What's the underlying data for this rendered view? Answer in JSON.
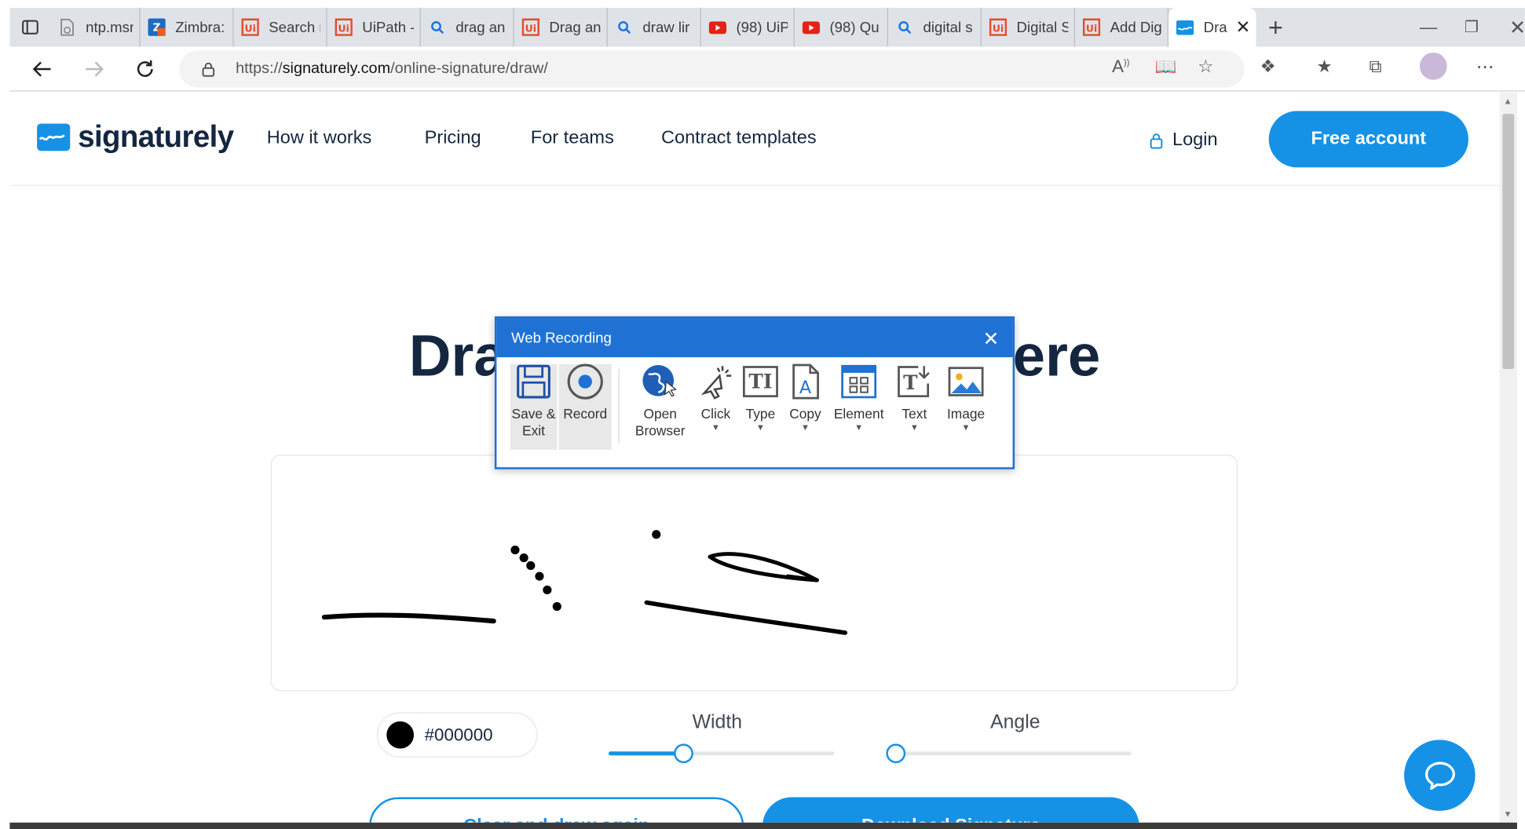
{
  "browser": {
    "tabs": [
      {
        "title": "ntp.msn",
        "icon": "msn-doc-icon",
        "icon_color": "#888888"
      },
      {
        "title": "Zimbra:",
        "icon": "zimbra-icon",
        "icon_color": "#1e6bc4"
      },
      {
        "title": "Search r",
        "icon": "uipath-icon",
        "icon_color": "#e8492b"
      },
      {
        "title": "UiPath -",
        "icon": "uipath-icon",
        "icon_color": "#e8492b"
      },
      {
        "title": "drag an",
        "icon": "search-icon",
        "icon_color": "#1a73e8"
      },
      {
        "title": "Drag an",
        "icon": "uipath-icon",
        "icon_color": "#e8492b"
      },
      {
        "title": "draw lir",
        "icon": "search-icon",
        "icon_color": "#1a73e8"
      },
      {
        "title": "(98) UiP",
        "icon": "youtube-icon",
        "icon_color": "#e62117"
      },
      {
        "title": "(98) Qu",
        "icon": "youtube-icon",
        "icon_color": "#e62117"
      },
      {
        "title": "digital s",
        "icon": "search-icon",
        "icon_color": "#1a73e8"
      },
      {
        "title": "Digital S",
        "icon": "uipath-icon",
        "icon_color": "#e8492b"
      },
      {
        "title": "Add Dig",
        "icon": "uipath-icon",
        "icon_color": "#e8492b"
      },
      {
        "title": "Dra",
        "icon": "signaturely-icon",
        "icon_color": "#1592e6",
        "active": true
      }
    ],
    "url_prefix": "https://",
    "url_domain": "signaturely.com",
    "url_path": "/online-signature/draw/"
  },
  "site": {
    "logo_text": "signaturely",
    "nav": [
      "How it works",
      "Pricing",
      "For teams",
      "Contract templates"
    ],
    "login_label": "Login",
    "free_account_label": "Free account",
    "hero_left": "Dra",
    "hero_right": "ere",
    "color_hex": "#000000",
    "width_label": "Width",
    "angle_label": "Angle",
    "width_value": 0.33,
    "angle_value": 0.0,
    "clear_label": "Clear and draw again",
    "download_label": "Download Signature",
    "accent": "#1592e6"
  },
  "recorder": {
    "title": "Web Recording",
    "tools": {
      "save": "Save & Exit",
      "record": "Record",
      "open_browser": "Open Browser",
      "click": "Click",
      "type": "Type",
      "copy": "Copy",
      "element": "Element",
      "text": "Text",
      "image": "Image"
    }
  }
}
